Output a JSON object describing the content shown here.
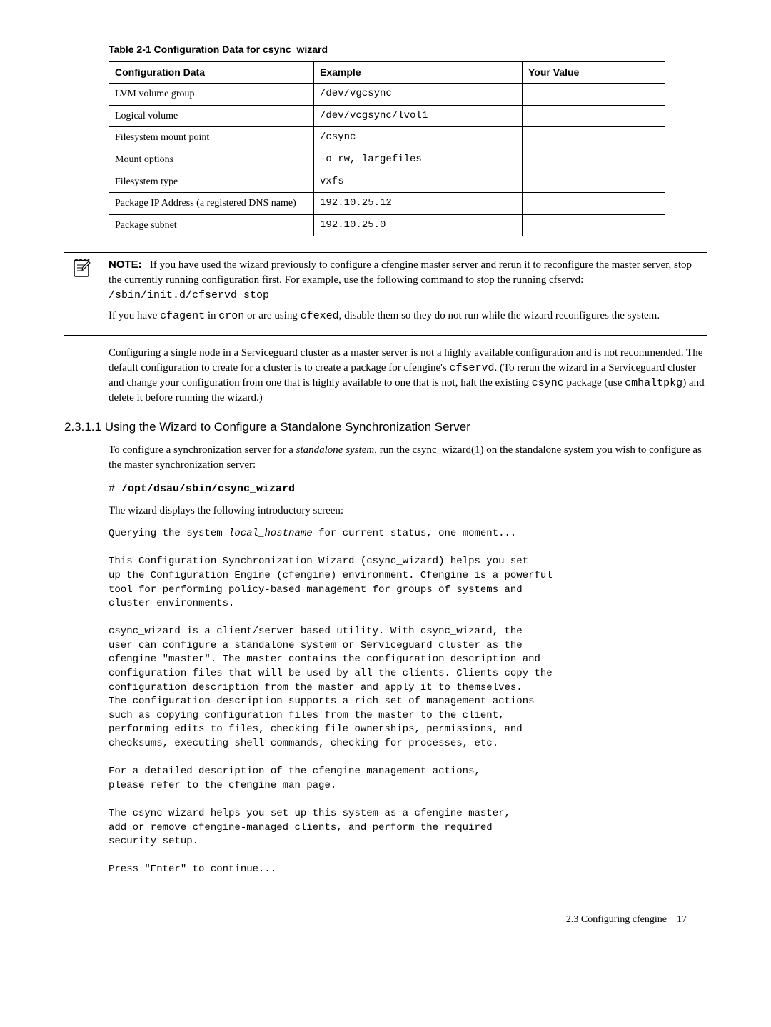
{
  "table": {
    "caption": "Table 2-1 Configuration Data for csync_wizard",
    "headers": [
      "Configuration Data",
      "Example",
      "Your Value"
    ],
    "rows": [
      {
        "c0": "LVM volume group",
        "c1": "/dev/vgcsync",
        "c2": ""
      },
      {
        "c0": "Logical volume",
        "c1": "/dev/vcgsync/lvol1",
        "c2": ""
      },
      {
        "c0": "Filesystem mount point",
        "c1": "/csync",
        "c2": ""
      },
      {
        "c0": "Mount options",
        "c1": "-o rw, largefiles",
        "c2": ""
      },
      {
        "c0": "Filesystem type",
        "c1": "vxfs",
        "c2": ""
      },
      {
        "c0": "Package IP Address (a registered DNS name)",
        "c1": "192.10.25.12",
        "c2": ""
      },
      {
        "c0": "Package subnet",
        "c1": "192.10.25.0",
        "c2": ""
      }
    ]
  },
  "note": {
    "label": "NOTE:",
    "p1a": "If you have used the wizard previously to configure a cfengine master server and rerun it to reconfigure the master server, stop the currently running configuration first. For example, use the following command to stop the running cfservd: ",
    "p1b": "/sbin/init.d/cfservd stop",
    "p2a": "If you have ",
    "p2b": "cfagent",
    "p2c": " in ",
    "p2d": "cron",
    "p2e": " or are using ",
    "p2f": "cfexed",
    "p2g": ", disable them so they do not run while the wizard reconfigures the system."
  },
  "para1": {
    "a": "Configuring a single node in a Serviceguard cluster as a master server is not a highly available configuration and is not recommended. The default configuration to create for a cluster is to create a package for cfengine's ",
    "b": "cfservd",
    "c": ". (To rerun the wizard in a Serviceguard cluster and change your configuration from one that is highly available to one that is not, halt the existing ",
    "d": "csync",
    "e": " package (use ",
    "f": "cmhaltpkg",
    "g": ") and delete it before running the wizard.)"
  },
  "section_heading": "2.3.1.1 Using the Wizard to Configure a Standalone Synchronization Server",
  "para2": {
    "a": "To configure a synchronization server for a ",
    "b": "standalone system",
    "c": ", run the csync_wizard(1) on the standalone system you wish to configure as the master synchronization server:"
  },
  "cmd": {
    "prompt": "# ",
    "text": "/opt/dsau/sbin/csync_wizard"
  },
  "para3": "The wizard displays the following introductory screen:",
  "screen_line1a": "Querying the system ",
  "screen_line1b": "local_hostname",
  "screen_line1c": " for current status, one moment...",
  "screen_rest": "\nThis Configuration Synchronization Wizard (csync_wizard) helps you set\nup the Configuration Engine (cfengine) environment. Cfengine is a powerful\ntool for performing policy-based management for groups of systems and\ncluster environments.\n\ncsync_wizard is a client/server based utility. With csync_wizard, the\nuser can configure a standalone system or Serviceguard cluster as the\ncfengine \"master\". The master contains the configuration description and\nconfiguration files that will be used by all the clients. Clients copy the\nconfiguration description from the master and apply it to themselves.\nThe configuration description supports a rich set of management actions\nsuch as copying configuration files from the master to the client,\nperforming edits to files, checking file ownerships, permissions, and\nchecksums, executing shell commands, checking for processes, etc.\n\nFor a detailed description of the cfengine management actions,\nplease refer to the cfengine man page.\n\nThe csync wizard helps you set up this system as a cfengine master,\nadd or remove cfengine-managed clients, and perform the required\nsecurity setup.\n\nPress \"Enter\" to continue...",
  "footer": {
    "left": "2.3 Configuring cfengine",
    "right": "17"
  }
}
